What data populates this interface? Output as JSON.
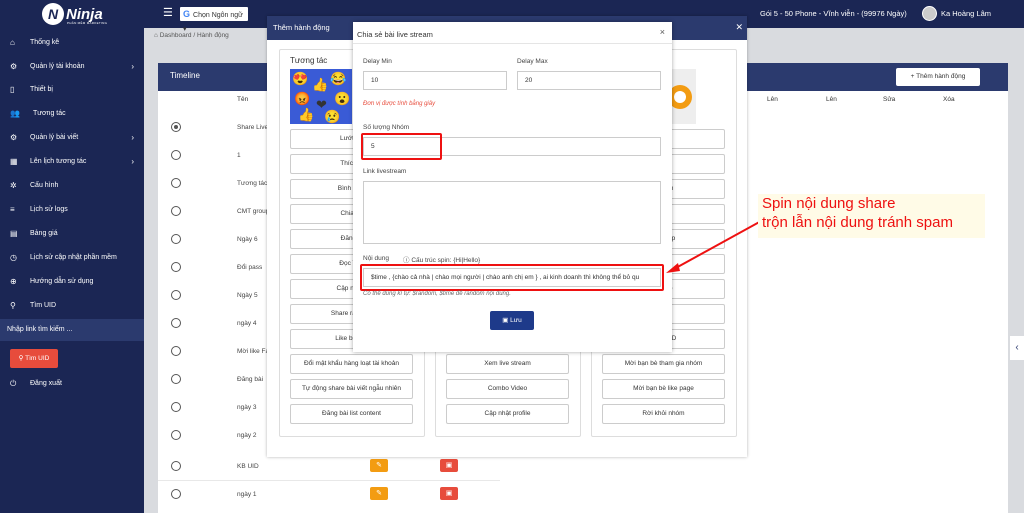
{
  "header": {
    "logo": "Ninja",
    "logo_sub": "PHẦN MỀM MARKETING",
    "lang": "Chọn Ngôn ngữ",
    "plan": "Gói 5 - 50 Phone - Vĩnh viễn - (99976 Ngày)",
    "user": "Ka Hoàng Lâm"
  },
  "sidebar": {
    "items": [
      {
        "label": "Thống kê",
        "icon": "home-icon"
      },
      {
        "label": "Quản lý tài khoản",
        "icon": "gear-icon"
      },
      {
        "label": "Thiết bị",
        "icon": "phone-icon"
      },
      {
        "label": "Tương tác",
        "icon": "users-icon"
      },
      {
        "label": "Quản lý bài viết",
        "icon": "gear-icon"
      },
      {
        "label": "Lên lịch tương tác",
        "icon": "calendar-icon"
      },
      {
        "label": "Cấu hình",
        "icon": "cog-icon"
      },
      {
        "label": "Lịch sử logs",
        "icon": "list-icon"
      },
      {
        "label": "Bảng giá",
        "icon": "table-icon"
      },
      {
        "label": "Lịch sử cập nhật phần mềm",
        "icon": "history-icon"
      },
      {
        "label": "Hướng dẫn sử dụng",
        "icon": "help-icon"
      },
      {
        "label": "Tìm UID",
        "icon": "search-icon"
      }
    ],
    "search_placeholder": "Nhập link tìm kiếm ...",
    "find_btn": "Tìm UID",
    "logout": "Đăng xuất"
  },
  "breadcrumb": {
    "home": "Dashboard",
    "current": "Hành động"
  },
  "timeline": {
    "title": "Timeline",
    "add_btn": "Thêm hành động",
    "cols": [
      "Tên",
      "Lên",
      "Lên",
      "Sửa",
      "Xóa"
    ],
    "rows": [
      "Share Live",
      "1",
      "Tương tác",
      "CMT group",
      "Ngày 6",
      "Đổi pass",
      "Ngày 5",
      "ngày 4",
      "Mời like Fa",
      "Đăng bài",
      "ngày 3",
      "ngày 2",
      "KB UID",
      "ngày 1"
    ]
  },
  "modal": {
    "title": "Thêm hành động",
    "col_title": "Tương tác",
    "col1": [
      "Lướt ne",
      "Thích B",
      "Bình luận",
      "Chia sẻ",
      "Đăng B",
      "Đọc Thô",
      "Cập nhật t",
      "Share random",
      "Like bài viế",
      "Đổi mật khẩu hàng loạt tài khoản",
      "Tự động share bài viết ngẫu nhiên",
      "Đăng bài list content"
    ],
    "col2": [
      "Xem live stream",
      "Combo Video",
      "Cập nhật profile"
    ],
    "col3": [
      "nhóm",
      "hóm",
      "stream",
      "page",
      "d Group",
      "group",
      "Group",
      "nhóm",
      "theo UID",
      "Mời bạn bè tham gia nhóm",
      "Mời bạn bè like page",
      "Rời khỏi nhóm"
    ]
  },
  "dialog": {
    "title": "Chia sẻ bài live stream",
    "delay_min_label": "Delay Min",
    "delay_min": "10",
    "delay_max_label": "Delay Max",
    "delay_max": "20",
    "unit_note": "Đơn vị được tính bằng giây",
    "group_label": "Số lượng Nhóm",
    "group_value": "5",
    "link_label": "Link livestream",
    "content_label": "Nội dung",
    "spin_label": "Cấu trúc spin: {Hi|Hello}",
    "content_value": "$time , {chào cả nhà | chào mọi người | chào anh chị em } , ai kinh doanh thì không thể bỏ qu",
    "content_note": "Có thể dùng kí tự: $random, $time để random nội dung.",
    "save": "Lưu"
  },
  "annotation": {
    "line1": "Spin nội dung share",
    "line2": "trộn lẫn nội dung tránh spam"
  }
}
